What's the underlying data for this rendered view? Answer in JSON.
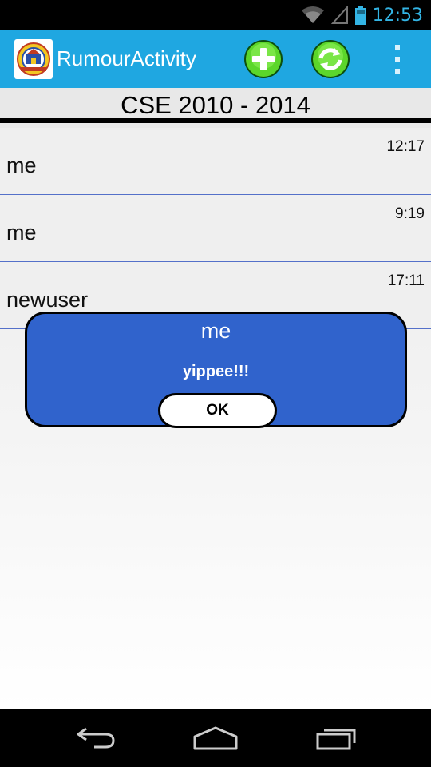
{
  "status_bar": {
    "time": "12:53",
    "icons": [
      "wifi-icon",
      "signal-icon",
      "battery-icon"
    ]
  },
  "action_bar": {
    "title": "RumourActivity",
    "logo": "app-logo-icon",
    "actions": [
      "add-icon",
      "refresh-icon",
      "overflow-menu-icon"
    ],
    "color": "#1fa7e1"
  },
  "group": {
    "name": "CSE 2010 - 2014"
  },
  "rumours": [
    {
      "author": "me",
      "time": "12:17"
    },
    {
      "author": "me",
      "time": "9:19"
    },
    {
      "author": "newuser",
      "time": "17:11"
    }
  ],
  "dialog": {
    "title": "me",
    "message": "yippee!!!",
    "ok_label": "OK",
    "background": "#3063cc"
  },
  "nav_bar": {
    "buttons": [
      "back-icon",
      "home-icon",
      "recents-icon"
    ]
  }
}
